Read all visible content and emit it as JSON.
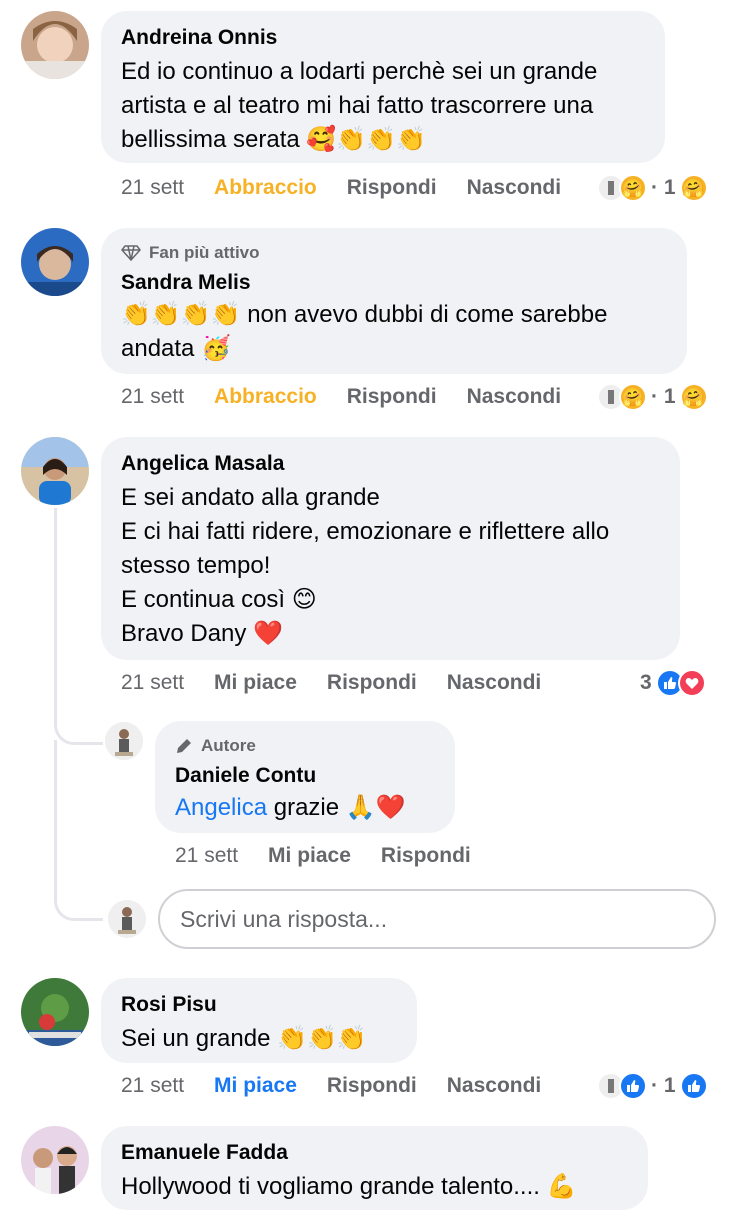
{
  "comments": [
    {
      "name": "Andreina Onnis",
      "text": "Ed io continuo a lodarti perchè sei un grande\nartista e al teatro mi hai fatto trascorrere una\nbellissima serata 🥰👏👏👏",
      "time": "21 sett",
      "reaction_label": "Abbraccio",
      "reply": "Rispondi",
      "hide": "Nascondi",
      "reaction_count": "· 1"
    },
    {
      "badge": "Fan più attivo",
      "name": "Sandra Melis",
      "text": "👏👏👏👏 non avevo dubbi di come sarebbe\nandata 🥳",
      "time": "21 sett",
      "reaction_label": "Abbraccio",
      "reply": "Rispondi",
      "hide": "Nascondi",
      "reaction_count": "· 1"
    },
    {
      "name": "Angelica Masala",
      "text": "E sei andato alla grande\nE ci hai fatti ridere, emozionare e riflettere allo\nstesso tempo!\nE continua così 😊\nBravo Dany ❤️",
      "time": "21 sett",
      "reaction_label": "Mi piace",
      "reply": "Rispondi",
      "hide": "Nascondi",
      "reaction_count": "3"
    },
    {
      "badge": "Autore",
      "name": "Daniele Contu",
      "mention": "Angelica",
      "text": " grazie 🙏❤️",
      "time": "21 sett",
      "reaction_label": "Mi piace",
      "reply": "Rispondi"
    },
    {
      "name": "Rosi Pisu",
      "text": "Sei un grande 👏👏👏",
      "time": "21 sett",
      "reaction_label": "Mi piace",
      "reply": "Rispondi",
      "hide": "Nascondi",
      "reaction_count": "· 1"
    },
    {
      "name": "Emanuele Fadda",
      "text": "Hollywood ti vogliamo grande talento.... 💪"
    }
  ],
  "reply_input": {
    "placeholder": "Scrivi una risposta..."
  },
  "colors": {
    "hug": "#f7b125",
    "like": "#1877f2",
    "bubble": "#f0f2f5",
    "muted": "#65676b"
  },
  "icons": [
    "diamond-icon",
    "pencil-icon",
    "hug-reaction-icon",
    "like-reaction-icon",
    "love-reaction-icon"
  ]
}
